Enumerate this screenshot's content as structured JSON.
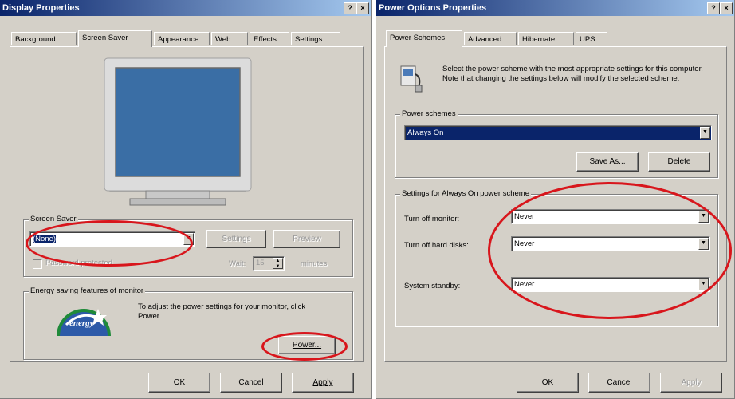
{
  "display": {
    "title": "Display Properties",
    "help_btn": "?",
    "close_btn": "×",
    "tabs": [
      "Background",
      "Screen Saver",
      "Appearance",
      "Web",
      "Effects",
      "Settings"
    ],
    "screen_saver_group": "Screen Saver",
    "screen_saver_value": "(None)",
    "settings_btn": "Settings",
    "preview_btn": "Preview",
    "password_label": "Password protected",
    "wait_label": "Wait:",
    "wait_value": "15",
    "minutes_label": "minutes",
    "energy_group": "Energy saving features of monitor",
    "energy_text": "To adjust the power settings for your monitor, click Power.",
    "energy_logo_text": "energy",
    "power_btn": "Power...",
    "ok": "OK",
    "cancel": "Cancel",
    "apply": "Apply"
  },
  "power": {
    "title": "Power Options Properties",
    "help_btn": "?",
    "close_btn": "×",
    "tabs": [
      "Power Schemes",
      "Advanced",
      "Hibernate",
      "UPS"
    ],
    "description": "Select the power scheme with the most appropriate settings for this computer. Note that changing the settings below will modify the selected scheme.",
    "schemes_group": "Power schemes",
    "scheme_value": "Always On",
    "save_as_btn": "Save As...",
    "delete_btn": "Delete",
    "settings_group": "Settings for Always On power scheme",
    "monitor_label": "Turn off monitor:",
    "monitor_value": "Never",
    "disks_label": "Turn off hard disks:",
    "disks_value": "Never",
    "standby_label": "System standby:",
    "standby_value": "Never",
    "ok": "OK",
    "cancel": "Cancel",
    "apply": "Apply"
  },
  "colors": {
    "title_start": "#0a246a",
    "title_end": "#a6caf0",
    "highlight": "#d8161c",
    "face": "#d4d0c8",
    "monitor_screen": "#3a6ea5"
  }
}
